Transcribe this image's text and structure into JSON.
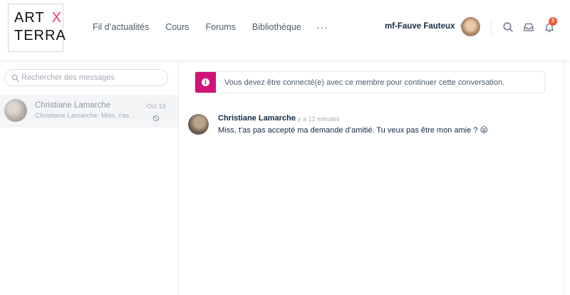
{
  "logo": {
    "line1": "ART",
    "x_mark": "X",
    "line2": "TERRA"
  },
  "nav": {
    "items": [
      {
        "label": "Fil d’actualités"
      },
      {
        "label": "Cours"
      },
      {
        "label": "Forums"
      },
      {
        "label": "Bibliothèque"
      }
    ],
    "more_label": "···"
  },
  "user": {
    "name": "mf-Fauve Fauteux",
    "caret_icon": "chevron-down-icon"
  },
  "header_icons": {
    "search_icon": "search-icon",
    "inbox_icon": "inbox-icon",
    "notifications_icon": "bell-icon",
    "notifications_count": "3"
  },
  "sidebar": {
    "search": {
      "placeholder": "Rechercher des messages",
      "value": ""
    },
    "threads": [
      {
        "name": "Christiane Lamarche",
        "date": "Oct 13",
        "preview": "Christiane Lamarche: Miss, t'as ...",
        "status_icon": "blocked-icon"
      }
    ]
  },
  "notice": {
    "icon": "info-icon",
    "icon_glyph": "i",
    "text": "Vous devez être connecté(e) avec ce membre pour continuer cette conversation."
  },
  "messages": [
    {
      "author": "Christiane Lamarche",
      "time": "Il y a 12 minutes",
      "text": "Miss, t’as pas accepté ma demande d’amitié. Tu veux pas être mon amie ? 😜"
    }
  ],
  "colors": {
    "accent": "#d1147a",
    "badge": "#ef5a37",
    "logo_x": "#e8356b",
    "text_primary": "#122b46",
    "text_muted": "#a6aeb7"
  }
}
